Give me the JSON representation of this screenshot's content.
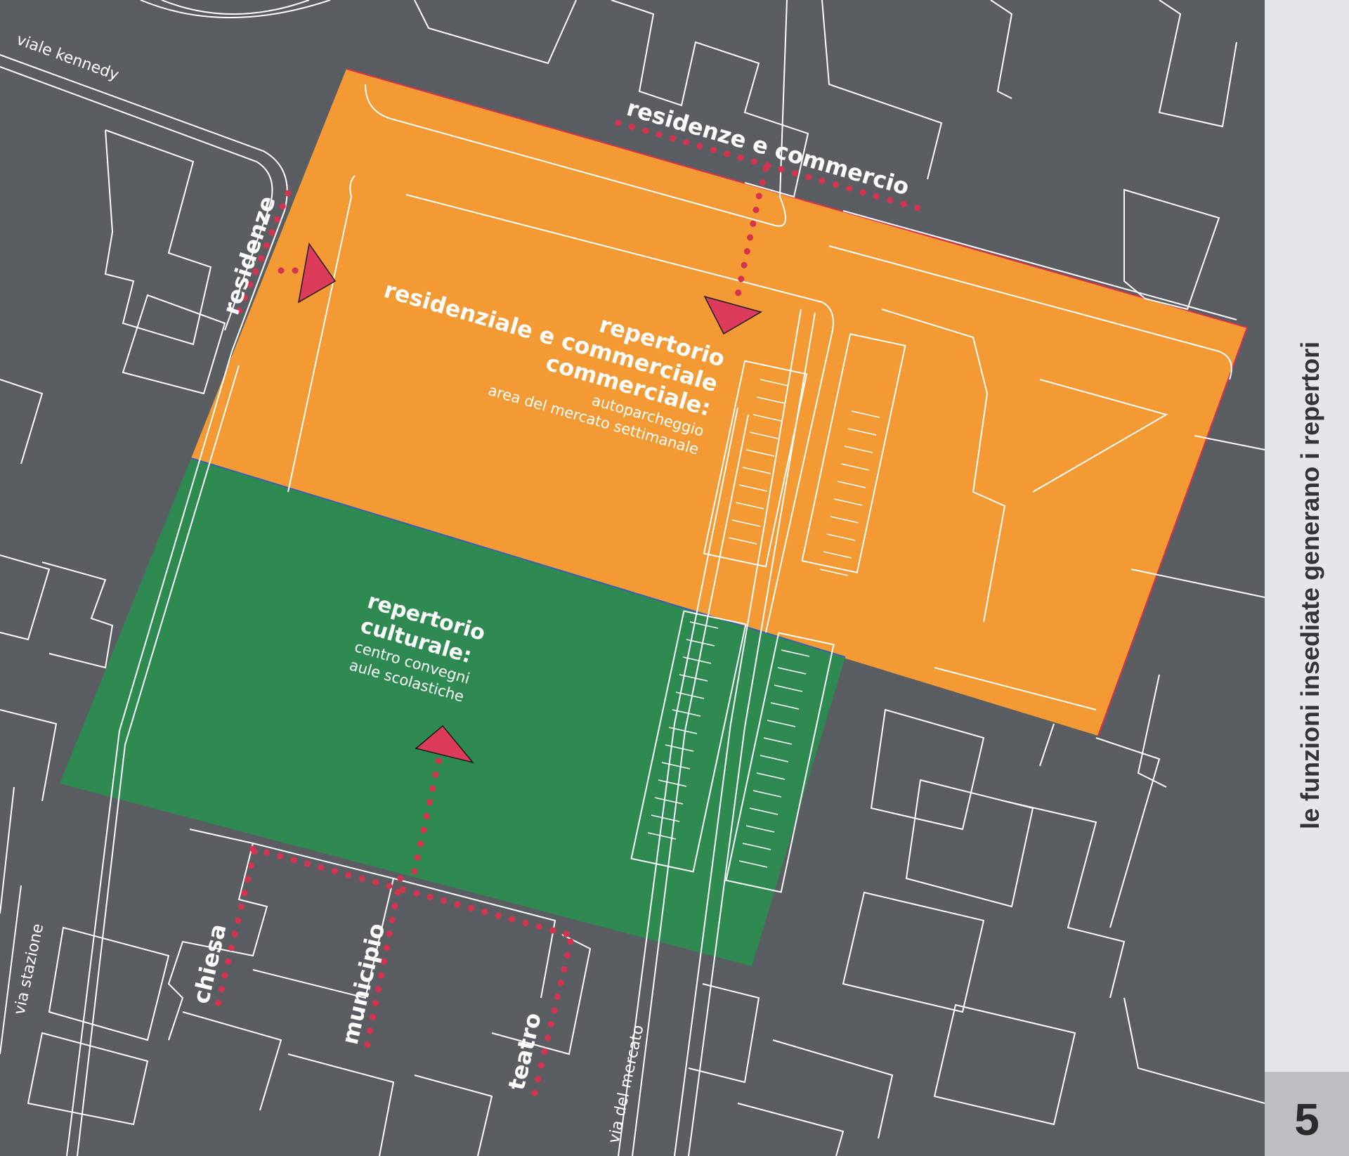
{
  "colors": {
    "background": "#5a5e63",
    "residential_zone": "#f39a35",
    "cultural_zone": "#2f8a52",
    "outline": "#ffffff",
    "path_dots": "#d6334f",
    "arrow": "#dc3c5a",
    "sidebar": "#e6e6ea",
    "page_number_box": "#bdbdc3"
  },
  "streets": {
    "viale_kennedy": "viale kennedy",
    "via_stazione": "via stazione",
    "via_del_mercato": "via del mercato"
  },
  "functions": {
    "residenze_commercio": "residenze e commercio",
    "residenze": "residenze",
    "chiesa": "chiesa",
    "municipio": "municipio",
    "teatro": "teatro"
  },
  "zones": {
    "residential": {
      "title_1": "repertorio",
      "title_2": "residenziale e commerciale",
      "title_3": "commerciale:",
      "sub_1": "autoparcheggio",
      "sub_2": "area del mercato settimanale"
    },
    "cultural": {
      "title_1": "repertorio",
      "title_2": "culturale:",
      "sub_1": "centro convegni",
      "sub_2": "aule scolastiche"
    }
  },
  "sidebar": {
    "title": "le funzioni insediate generano i repertori",
    "page_number": "5"
  }
}
